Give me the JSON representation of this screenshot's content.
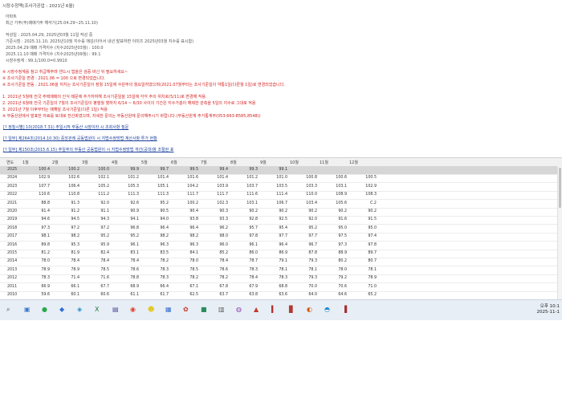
{
  "page_title": "시장수정맥(조사가공업 : 2021년 6월)",
  "info": {
    "heading": "아파트",
    "subheading": "최근 가주(주)매매가주 해석기(25.04.29~25.11.10)",
    "lines": [
      "작성일 : 2025.04.29, 2025년03월 11일 작성 중",
      "기준시점 : 2025.11.10, 2025년10월 지수를 매김(이어서 내년 발표하면 이미즈 2025년03월 지수를 표시함)",
      "2025.04.29 매매 가격지수 (지수2025년03월) : 100.0",
      "2025.11.10 매매 가격지수 (지수2025년09월) : 99.1",
      "시장수정계 : 99.1/100.0=0.9910"
    ]
  },
  "notices": {
    "n1": "※ 시장수정계를 참고 취급해주며 센드시 앱을은 검증 바신 뒤 필요하세요~",
    "n2": "※ 조사기준일 변경 : 2021.06 = 100 으로 변경되었습니다.",
    "n3": "※ 조사기준일 변동 : 2021.06을 저지는 조사기준일이 정월 15일에 수원주의 월요일하였으며(2021.07월부터는 조사기준일이 약통1일(다른월 1일)로 변경되었습니다.",
    "n4": "1. 2021년 5월에 전국 주택매매의 인식 때문에 추가하여해 조사기준일을 15일에 각각 주의 위치로(5/11)로 변경해 작용.",
    "n5": "2. 2021년 6월에 전국 기준일의 7월의 조사기준일이 평행월 했하지 6/14 ~ 6/30 사이의 기간은 지수가층이 해제한 관측을 5일의 지수로 그대로 적용",
    "n6": "3. 2021년 7월 이후부터는 매해달 조사기준일(다른 1일) 적용",
    "n7": "※ 부동산원에서 발표한 자료를 토대로 전산화였으며, 자세한 문의는 부동산원에 문의해주시기 바랍니다.(부동산원계 주거통계부(053-663-8585,8548))"
  },
  "links": {
    "l1": "[? 정칠시별] 10(2018.7.31) 주일시작 부동산 시장이라 시 조회사항 질문",
    "l2": "[?  일부] 제264조(2014.10.30) 중앙관례 공동법원이 시 지법수정방법 계산사항 투가 현황",
    "l3": "[?  일부] 제150조(2015.6.15) 주일주의 부동산 공동법원이 시 지법수정방법 개선(공대)항 조절된 표"
  },
  "table": {
    "headers": [
      "연도",
      "1월",
      "2월",
      "3월",
      "4월",
      "5월",
      "6월",
      "7월",
      "8월",
      "9월",
      "10월",
      "11월",
      "12월"
    ],
    "rows": [
      [
        "2025",
        "100.4",
        "100.2",
        "100.0",
        "99.9",
        "99.7",
        "99.5",
        "99.4",
        "99.3",
        "99.1",
        "",
        "",
        ""
      ],
      [
        "2024",
        "102.9",
        "102.6",
        "102.1",
        "101.2",
        "101.4",
        "101.6",
        "101.4",
        "101.2",
        "101.0",
        "100.8",
        "100.6",
        "100.5"
      ],
      [
        "2023",
        "107.7",
        "106.4",
        "105.2",
        "105.3",
        "105.1",
        "104.2",
        "103.9",
        "103.7",
        "103.5",
        "103.3",
        "103.1",
        "102.9"
      ],
      [
        "2022",
        "110.6",
        "110.8",
        "111.2",
        "111.3",
        "111.3",
        "111.7",
        "111.7",
        "111.6",
        "111.4",
        "110.0",
        "108.9",
        "108.3"
      ],
      [
        "2021",
        "88.8",
        "91.3",
        "92.0",
        "92.6",
        "95.2",
        "100.2",
        "102.3",
        "103.1",
        "106.7",
        "103.4",
        "105.6",
        "C.2"
      ],
      [
        "2020",
        "91.4",
        "91.2",
        "91.1",
        "90.9",
        "90.5",
        "90.4",
        "90.3",
        "90.2",
        "90.2",
        "90.2",
        "90.2",
        "90.2"
      ],
      [
        "2019",
        "94.6",
        "94.5",
        "94.3",
        "94.1",
        "94.0",
        "93.8",
        "93.3",
        "92.8",
        "92.5",
        "92.0",
        "91.6",
        "91.5"
      ],
      [
        "2018",
        "97.3",
        "97.2",
        "97.2",
        "96.8",
        "96.4",
        "96.4",
        "96.2",
        "95.7",
        "95.4",
        "95.2",
        "95.0",
        "95.0"
      ],
      [
        "2017",
        "98.1",
        "98.2",
        "95.2",
        "95.2",
        "98.2",
        "98.2",
        "98.0",
        "97.8",
        "97.7",
        "97.7",
        "97.5",
        "97.4"
      ],
      [
        "2016",
        "89.8",
        "95.3",
        "95.9",
        "96.1",
        "96.3",
        "96.3",
        "96.0",
        "96.1",
        "96.4",
        "96.7",
        "97.3",
        "97.8"
      ],
      [
        "2015",
        "81.2",
        "81.9",
        "82.4",
        "83.1",
        "83.5",
        "84.1",
        "85.2",
        "86.0",
        "86.9",
        "87.8",
        "88.9",
        "89.7"
      ],
      [
        "2014",
        "78.0",
        "78.4",
        "78.4",
        "78.4",
        "78.2",
        "78.0",
        "78.4",
        "78.7",
        "79.1",
        "79.3",
        "80.2",
        "80.7"
      ],
      [
        "2013",
        "78.9",
        "78.9",
        "78.5",
        "78.6",
        "78.3",
        "78.5",
        "78.6",
        "78.3",
        "78.1",
        "78.1",
        "78.0",
        "78.1"
      ],
      [
        "2012",
        "78.3",
        "71.4",
        "71.6",
        "78.8",
        "78.3",
        "78.2",
        "78.2",
        "78.4",
        "78.3",
        "79.3",
        "79.2",
        "78.9"
      ],
      [
        "2011",
        "66.9",
        "66.1",
        "67.7",
        "68.9",
        "66.4",
        "67.1",
        "67.8",
        "67.9",
        "68.8",
        "70.0",
        "70.6",
        "71.0"
      ],
      [
        "2010",
        "59.6",
        "60.1",
        "60.6",
        "61.1",
        "61.7",
        "62.5",
        "63.7",
        "63.8",
        "63.6",
        "64.0",
        "64.6",
        "65.2"
      ]
    ]
  },
  "taskbar": {
    "apps": [
      {
        "name": "search-icon",
        "glyph": "⌕",
        "color": "#4a4a4a"
      },
      {
        "name": "task-view-icon",
        "glyph": "▣",
        "color": "#3a78c8"
      },
      {
        "name": "app-1-icon",
        "glyph": "●",
        "color": "#2aa84a"
      },
      {
        "name": "app-2-icon",
        "glyph": "◆",
        "color": "#2e6ed9"
      },
      {
        "name": "app-3-icon",
        "glyph": "◈",
        "color": "#1b8fd2"
      },
      {
        "name": "excel-icon",
        "glyph": "X",
        "color": "#1f7a3f"
      },
      {
        "name": "app-4-icon",
        "glyph": "▤",
        "color": "#4a4a9a"
      },
      {
        "name": "chrome-icon",
        "glyph": "◉",
        "color": "#d6462e"
      },
      {
        "name": "kakaotalk-icon",
        "glyph": "☻",
        "color": "#e2c400"
      },
      {
        "name": "app-5-icon",
        "glyph": "▦",
        "color": "#3a6fd0"
      },
      {
        "name": "app-6-icon",
        "glyph": "✿",
        "color": "#c0392b"
      },
      {
        "name": "app-7-icon",
        "glyph": "■",
        "color": "#2b8c5a"
      },
      {
        "name": "app-8-icon",
        "glyph": "▥",
        "color": "#5a5a5a"
      },
      {
        "name": "app-9-icon",
        "glyph": "◍",
        "color": "#8e44ad"
      },
      {
        "name": "app-10-icon",
        "glyph": "▲",
        "color": "#c0392b"
      },
      {
        "name": "app-11-icon",
        "glyph": "▍",
        "color": "#b03030"
      },
      {
        "name": "app-12-icon",
        "glyph": "▊",
        "color": "#b03a2e"
      },
      {
        "name": "app-13-icon",
        "glyph": "◐",
        "color": "#d35400"
      },
      {
        "name": "edge-icon",
        "glyph": "◓",
        "color": "#1c8ad3"
      },
      {
        "name": "app-14-icon",
        "glyph": "▐",
        "color": "#a33030"
      }
    ],
    "clock_time": "오후 10:1",
    "clock_date": "2025-11-1"
  }
}
